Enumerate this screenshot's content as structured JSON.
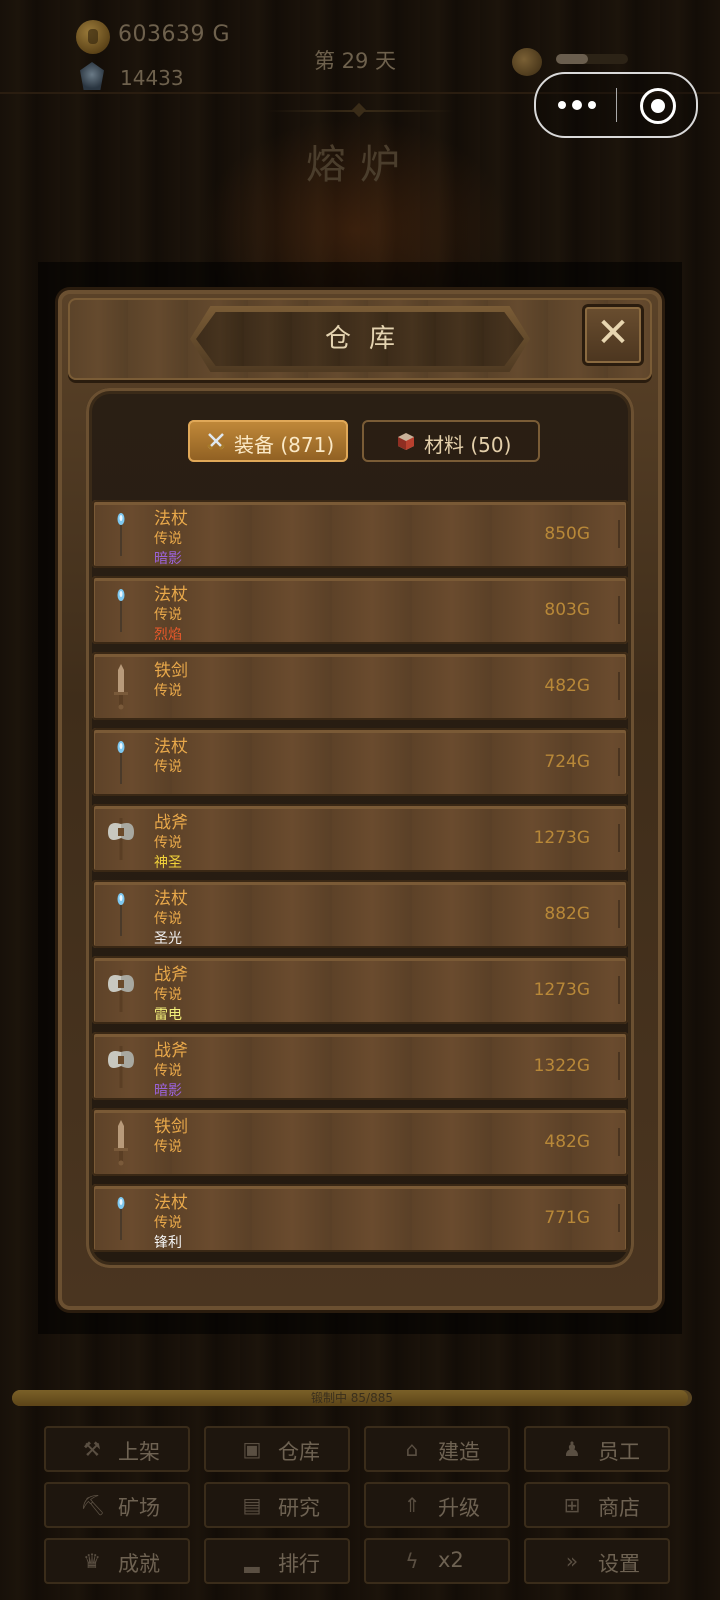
{
  "hud": {
    "gold": "603639 G",
    "gems": "14433",
    "day": "第 29 天",
    "energy_fraction": 0.45
  },
  "location_title": "熔炉",
  "panel": {
    "title": "仓库",
    "close_label": "✕",
    "tabs": [
      {
        "label": "装备 (871)",
        "icon": "crossed-swords-icon",
        "active": true
      },
      {
        "label": "材料 (50)",
        "icon": "material-box-icon",
        "active": false
      }
    ]
  },
  "items": [
    {
      "name": "法杖",
      "rarity": "传说",
      "affix": "暗影",
      "affix_color": "#9a62d8",
      "price": "850G",
      "icon": "staff-icon"
    },
    {
      "name": "法杖",
      "rarity": "传说",
      "affix": "烈焰",
      "affix_color": "#e8582a",
      "price": "803G",
      "icon": "staff-icon"
    },
    {
      "name": "铁剑",
      "rarity": "传说",
      "affix": "",
      "affix_color": "",
      "price": "482G",
      "icon": "sword-icon"
    },
    {
      "name": "法杖",
      "rarity": "传说",
      "affix": "",
      "affix_color": "",
      "price": "724G",
      "icon": "staff-icon"
    },
    {
      "name": "战斧",
      "rarity": "传说",
      "affix": "神圣",
      "affix_color": "#f2d23a",
      "price": "1273G",
      "icon": "battle-axe-icon"
    },
    {
      "name": "法杖",
      "rarity": "传说",
      "affix": "圣光",
      "affix_color": "#f2f2f2",
      "price": "882G",
      "icon": "staff-icon"
    },
    {
      "name": "战斧",
      "rarity": "传说",
      "affix": "雷电",
      "affix_color": "#f4f07a",
      "price": "1273G",
      "icon": "battle-axe-icon"
    },
    {
      "name": "战斧",
      "rarity": "传说",
      "affix": "暗影",
      "affix_color": "#9a62d8",
      "price": "1322G",
      "icon": "battle-axe-icon"
    },
    {
      "name": "铁剑",
      "rarity": "传说",
      "affix": "",
      "affix_color": "",
      "price": "482G",
      "icon": "sword-icon"
    },
    {
      "name": "法杖",
      "rarity": "传说",
      "affix": "锋利",
      "affix_color": "#f2f2f2",
      "price": "771G",
      "icon": "staff-icon"
    }
  ],
  "progress": {
    "label": "锻制中 85/885",
    "fraction": 0.994
  },
  "bottom_buttons": [
    {
      "label": "上架",
      "icon": "hammer-icon"
    },
    {
      "label": "仓库",
      "icon": "chest-icon"
    },
    {
      "label": "建造",
      "icon": "building-icon"
    },
    {
      "label": "员工",
      "icon": "worker-icon"
    },
    {
      "label": "矿场",
      "icon": "pickaxe-icon"
    },
    {
      "label": "研究",
      "icon": "book-icon"
    },
    {
      "label": "升级",
      "icon": "upgrade-chevrons-icon"
    },
    {
      "label": "商店",
      "icon": "cart-icon"
    },
    {
      "label": "成就",
      "icon": "trophy-icon"
    },
    {
      "label": "排行",
      "icon": "podium-icon"
    },
    {
      "label": "x2",
      "icon": "lightning-icon"
    },
    {
      "label": "设置",
      "icon": "fast-forward-icon"
    }
  ],
  "colors": {
    "legendary": "#e8a84a",
    "price": "#b88838",
    "tab_active": "#c28a3a"
  }
}
